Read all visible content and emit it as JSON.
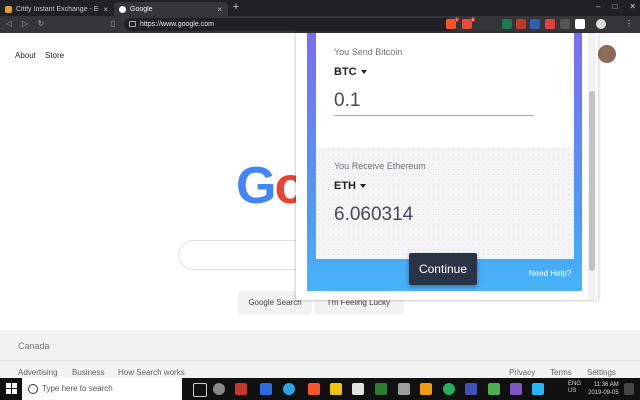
{
  "tabs": [
    {
      "title": "Citify Instant Exchange - Edit Item",
      "close": "×"
    },
    {
      "title": "Google",
      "close": "×"
    }
  ],
  "newtab": "+",
  "window_controls": {
    "minimize": "–",
    "maximize": "□",
    "close": "✕"
  },
  "address": {
    "url": "https://www.google.com"
  },
  "extension_badges": {
    "brave": "1",
    "ext2": "5"
  },
  "google": {
    "about": "About",
    "store": "Store",
    "logo": {
      "g": "G",
      "o": "o"
    },
    "search_button": "Google Search",
    "lucky_button": "I'm Feeling Lucky",
    "country": "Canada",
    "footer_left": [
      "Advertising",
      "Business",
      "How Search works"
    ],
    "footer_right": [
      "Privacy",
      "Terms",
      "Settings"
    ]
  },
  "popup": {
    "send_label": "You Send Bitcoin",
    "send_coin": "BTC",
    "send_amount": "0.1",
    "receive_label": "You Receive Ethereum",
    "receive_coin": "ETH",
    "receive_amount": "6.060314",
    "continue": "Continue",
    "help": "Need Help?"
  },
  "taskbar": {
    "search_placeholder": "Type here to search",
    "language": "ENG\nUS",
    "time": "11:36 AM",
    "date": "2019-09-05"
  },
  "colors": {
    "tab_bar": "#202124",
    "toolbar": "#35363a",
    "popup_gradient_top": "#7b6cf6",
    "popup_gradient_bottom": "#46b4f8",
    "continue_button": "#2b3347",
    "google_blue": "#4285f4",
    "google_red": "#ea4335"
  }
}
